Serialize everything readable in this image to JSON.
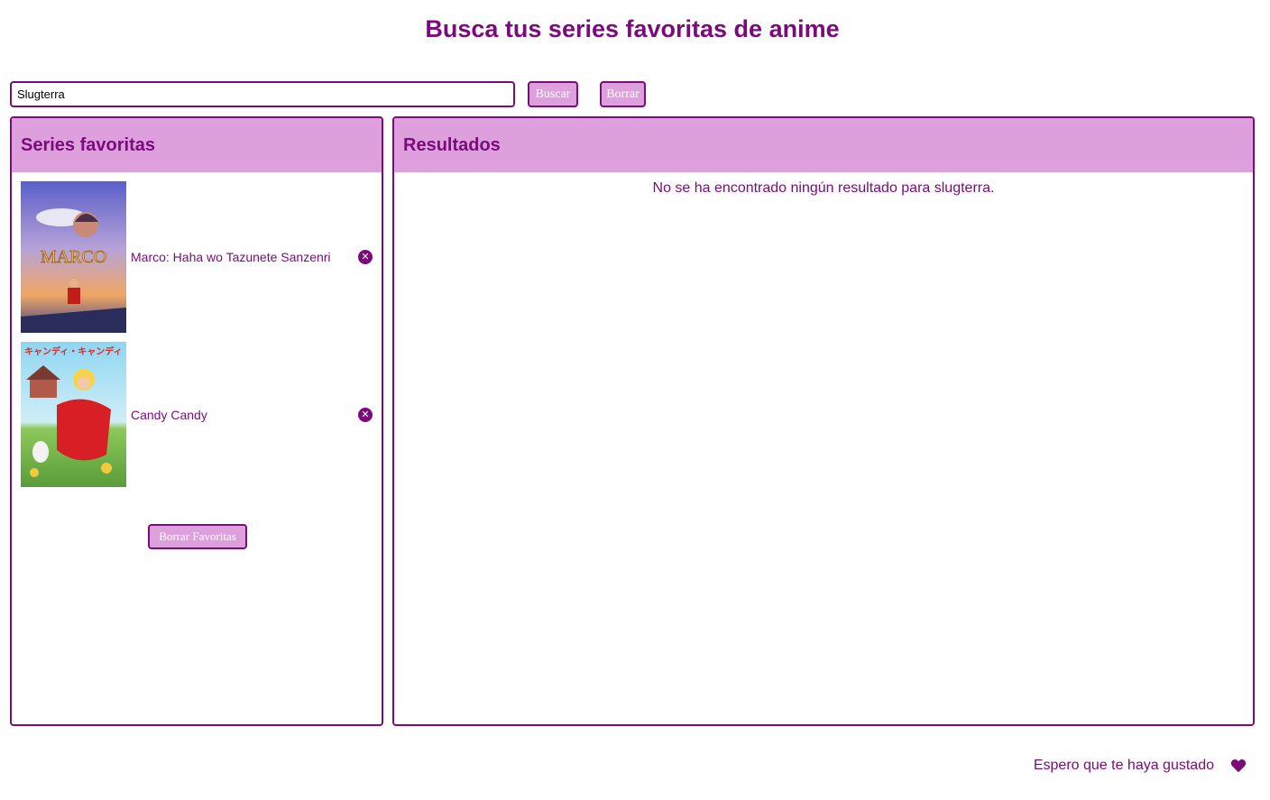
{
  "header": {
    "title": "Busca tus series favoritas de anime"
  },
  "search": {
    "value": "Slugterra",
    "search_label": "Buscar",
    "clear_label": "Borrar"
  },
  "favorites": {
    "title": "Series favoritas",
    "items": [
      {
        "name": "Marco: Haha wo Tazunete Sanzenri",
        "poster_text": "MARCO",
        "remove_icon": "close-circle-icon"
      },
      {
        "name": "Candy Candy",
        "poster_text": "キャンディ・キャンディ",
        "remove_icon": "close-circle-icon"
      }
    ],
    "clear_all_label": "Borrar Favoritas"
  },
  "results": {
    "title": "Resultados",
    "message": "No se ha encontrado ningún resultado para slugterra."
  },
  "footer": {
    "text": "Espero que te haya gustado",
    "icon": "heart-icon"
  },
  "colors": {
    "primary": "#7b0a7b",
    "accent": "#dda0dd",
    "background": "#ffffff"
  }
}
